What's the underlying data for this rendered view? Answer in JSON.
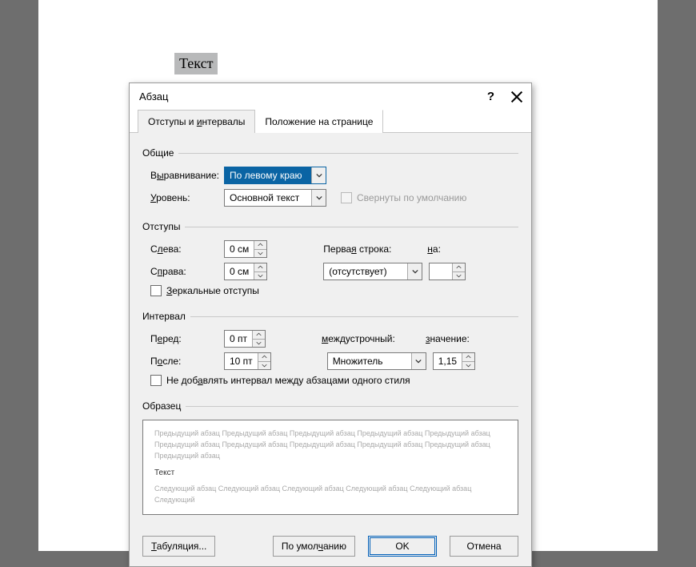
{
  "doc": {
    "selected_text": "Текст"
  },
  "dialog": {
    "title": "Абзац",
    "tabs": {
      "indents": "Отступы и интервалы",
      "position": "Положение на странице"
    },
    "groups": {
      "general": {
        "title": "Общие",
        "alignment_label": "Выравнивание:",
        "alignment_value": "По левому краю",
        "level_label": "Уровень:",
        "level_value": "Основной текст",
        "collapsed_label": "Свернуты по умолчанию"
      },
      "indents": {
        "title": "Отступы",
        "left_label": "Слева:",
        "left_value": "0 см",
        "right_label": "Справа:",
        "right_value": "0 см",
        "first_line_label": "Первая строка:",
        "first_line_value": "(отсутствует)",
        "by_label": "на:",
        "by_value": "",
        "mirror_label": "Зеркальные отступы"
      },
      "spacing": {
        "title": "Интервал",
        "before_label": "Перед:",
        "before_value": "0 пт",
        "after_label": "После:",
        "after_value": "10 пт",
        "line_label": "междустрочный:",
        "line_value": "Множитель",
        "at_label": "значение:",
        "at_value": "1,15",
        "no_space_label": "Не добавлять интервал между абзацами одного стиля"
      },
      "preview": {
        "title": "Образец",
        "prev": "Предыдущий абзац Предыдущий абзац Предыдущий абзац Предыдущий абзац Предыдущий абзац Предыдущий абзац Предыдущий абзац Предыдущий абзац Предыдущий абзац Предыдущий абзац Предыдущий абзац",
        "main": "Текст",
        "next": "Следующий абзац Следующий абзац Следующий абзац Следующий абзац Следующий абзац Следующий"
      }
    },
    "footer": {
      "tabs_btn": "Табуляция...",
      "default_btn": "По умолчанию",
      "ok_btn": "OK",
      "cancel_btn": "Отмена"
    }
  }
}
